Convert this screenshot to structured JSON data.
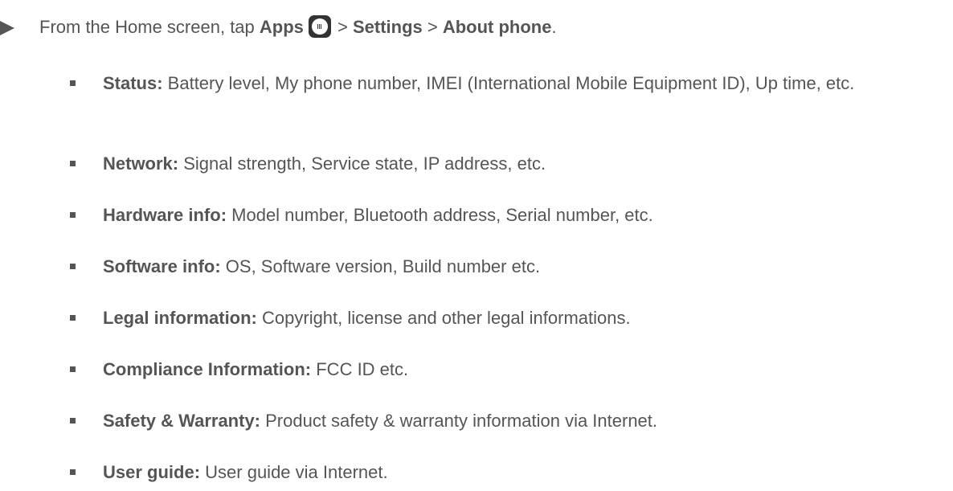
{
  "step": {
    "prefix": "From the Home screen, tap ",
    "apps": "Apps",
    "sep1": " > ",
    "settings": "Settings",
    "sep2": " > ",
    "about": "About phone",
    "period": ".",
    "arrow_icon": "triangle-right-icon",
    "apps_icon": "apps-grid-icon"
  },
  "items": [
    {
      "label": "Status:",
      "text": " Battery level, My phone number, IMEI (International Mobile Equipment ID), Up time, etc."
    },
    {
      "label": "Network:",
      "text": " Signal strength, Service state, IP address, etc."
    },
    {
      "label": "Hardware info:",
      "text": " Model number, Bluetooth address, Serial number, etc."
    },
    {
      "label": "Software info:",
      "text": " OS, Software version, Build number etc."
    },
    {
      "label": "Legal information:",
      "text": " Copyright, license and other legal informations."
    },
    {
      "label": "Compliance Information:",
      "text": " FCC ID etc."
    },
    {
      "label": "Safety & Warranty:",
      "text": " Product safety & warranty information via Internet."
    },
    {
      "label": "User guide:",
      "text": " User guide via Internet."
    }
  ]
}
